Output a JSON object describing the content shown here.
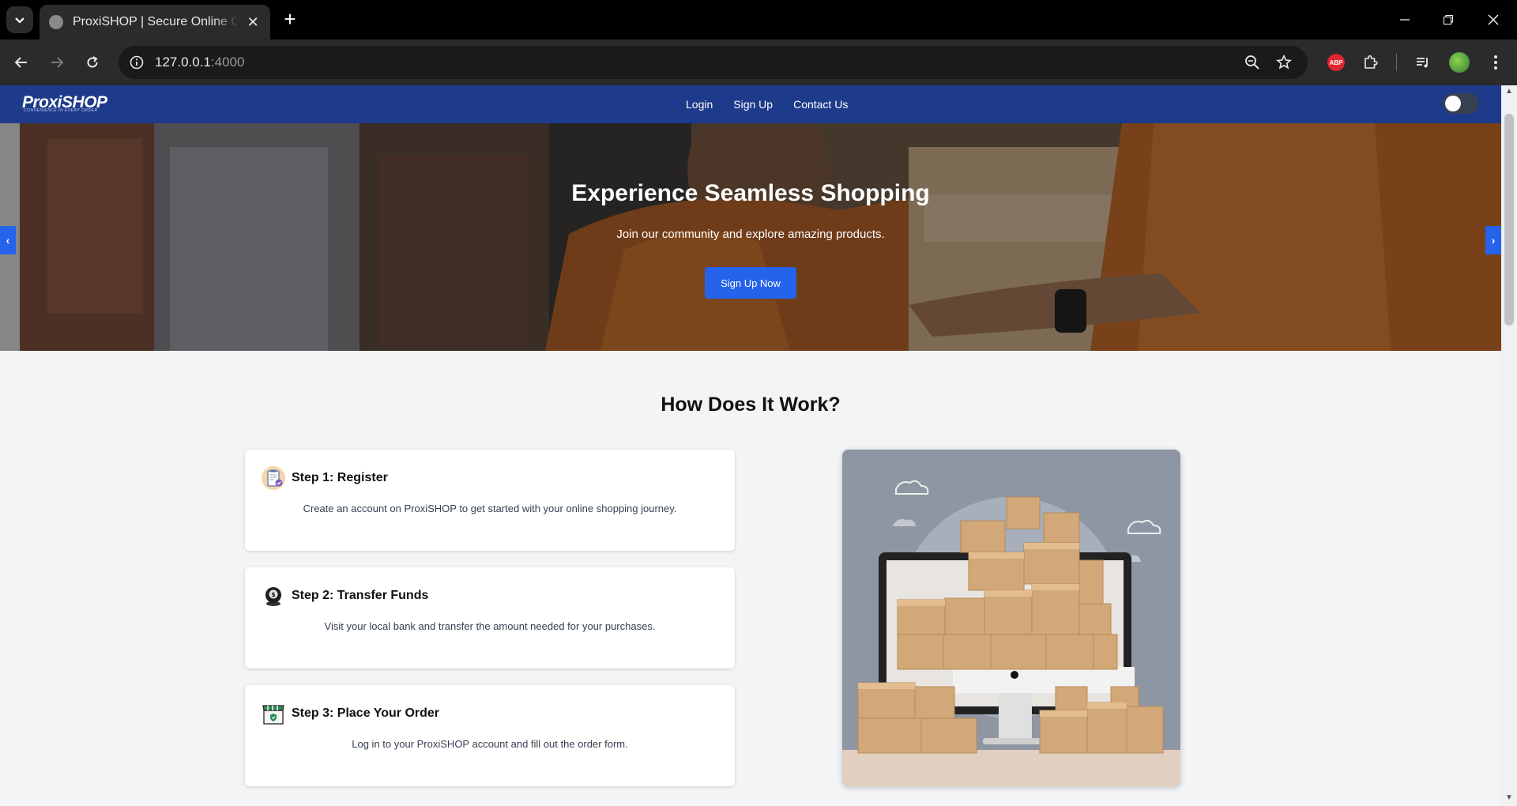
{
  "browser": {
    "tab_title": "ProxiSHOP | Secure Online Order",
    "url_host": "127.0.0.1",
    "url_port": ":4000",
    "abp_label": "ABP"
  },
  "site": {
    "logo": "ProxiSHOP",
    "logo_tagline": "CONVENIENCE IN EVERY ORDER",
    "nav": [
      {
        "label": "Login"
      },
      {
        "label": "Sign Up"
      },
      {
        "label": "Contact Us"
      }
    ]
  },
  "hero": {
    "title": "Experience Seamless Shopping",
    "subtitle": "Join our community and explore amazing products.",
    "cta": "Sign Up Now",
    "prev": "‹",
    "next": "›"
  },
  "how": {
    "title": "How Does It Work?",
    "steps": [
      {
        "title": "Step 1: Register",
        "desc": "Create an account on ProxiSHOP to get started with your online shopping journey.",
        "icon": "clipboard-icon"
      },
      {
        "title": "Step 2: Transfer Funds",
        "desc": "Visit your local bank and transfer the amount needed for your purchases.",
        "icon": "piggy-bank-icon"
      },
      {
        "title": "Step 3: Place Your Order",
        "desc": "Log in to your ProxiSHOP account and fill out the order form.",
        "icon": "store-icon"
      }
    ]
  },
  "colors": {
    "nav_bg": "#1e3a8a",
    "accent": "#2563eb"
  }
}
